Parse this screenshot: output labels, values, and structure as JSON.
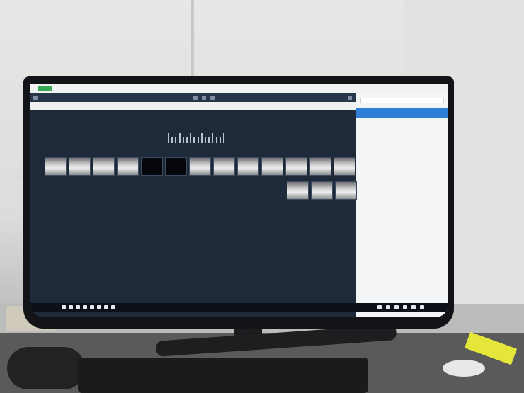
{
  "scene": {
    "description_free": true
  },
  "app": {
    "window_title": "",
    "header_label": "",
    "header_right": "",
    "user": ""
  },
  "chart_label": "",
  "xrays": [
    {
      "tone": "light",
      "label": ""
    },
    {
      "tone": "light",
      "label": ""
    },
    {
      "tone": "light",
      "label": ""
    },
    {
      "tone": "light",
      "label": ""
    },
    {
      "tone": "dark",
      "label": ""
    },
    {
      "tone": "dark",
      "label": ""
    },
    {
      "tone": "light",
      "label": ""
    },
    {
      "tone": "light",
      "label": ""
    },
    {
      "tone": "light",
      "label": ""
    },
    {
      "tone": "light",
      "label": ""
    },
    {
      "tone": "light",
      "label": ""
    },
    {
      "tone": "light",
      "label": ""
    },
    {
      "tone": "light",
      "label": ""
    },
    {
      "tone": "light",
      "label": ""
    },
    {
      "tone": "light",
      "label": ""
    },
    {
      "tone": "light",
      "label": ""
    }
  ],
  "panel": {
    "selected": "",
    "items": [
      "",
      "",
      "",
      ""
    ]
  },
  "colors": {
    "accent": "#2f7ed8",
    "logo": "#3aa757",
    "screen_bg": "#1e2a3a"
  }
}
